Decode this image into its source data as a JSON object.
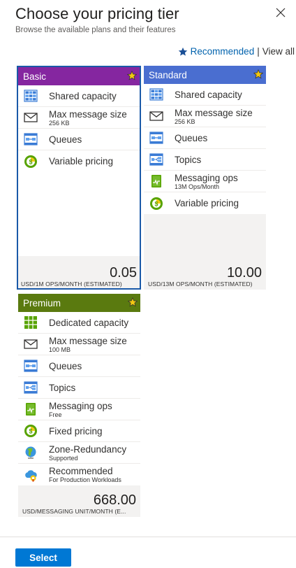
{
  "header": {
    "title": "Choose your pricing tier",
    "subtitle": "Browse the available plans and their features"
  },
  "filters": {
    "recommended_label": "Recommended",
    "separator": "|",
    "view_all_label": "View all"
  },
  "colors": {
    "basic": "#8526a0",
    "standard": "#4a6ed0",
    "premium": "#5a7a0f",
    "accent": "#0078d4",
    "selected_outline": "#1a59a8",
    "star": "#f2c811"
  },
  "tiers": {
    "basic": {
      "name": "Basic",
      "selected": true,
      "features": [
        {
          "icon": "shared-capacity-icon",
          "name": "Shared capacity",
          "detail": ""
        },
        {
          "icon": "envelope-icon",
          "name": "Max message size",
          "detail": "256 KB"
        },
        {
          "icon": "queue-icon",
          "name": "Queues",
          "detail": ""
        },
        {
          "icon": "pricing-coin-icon",
          "name": "Variable pricing",
          "detail": ""
        }
      ],
      "price": "0.05",
      "price_unit": "USD/1M OPS/MONTH (ESTIMATED)"
    },
    "standard": {
      "name": "Standard",
      "selected": false,
      "features": [
        {
          "icon": "shared-capacity-icon",
          "name": "Shared capacity",
          "detail": ""
        },
        {
          "icon": "envelope-icon",
          "name": "Max message size",
          "detail": "256 KB"
        },
        {
          "icon": "queue-icon",
          "name": "Queues",
          "detail": ""
        },
        {
          "icon": "topics-icon",
          "name": "Topics",
          "detail": ""
        },
        {
          "icon": "messaging-ops-icon",
          "name": "Messaging ops",
          "detail": "13M Ops/Month"
        },
        {
          "icon": "pricing-coin-icon",
          "name": "Variable pricing",
          "detail": ""
        }
      ],
      "price": "10.00",
      "price_unit": "USD/13M OPS/MONTH (ESTIMATED)"
    },
    "premium": {
      "name": "Premium",
      "selected": false,
      "features": [
        {
          "icon": "dedicated-capacity-icon",
          "name": "Dedicated capacity",
          "detail": ""
        },
        {
          "icon": "envelope-icon",
          "name": "Max message size",
          "detail": "100 MB"
        },
        {
          "icon": "queue-icon",
          "name": "Queues",
          "detail": ""
        },
        {
          "icon": "topics-icon",
          "name": "Topics",
          "detail": ""
        },
        {
          "icon": "messaging-ops-icon",
          "name": "Messaging ops",
          "detail": "Free"
        },
        {
          "icon": "pricing-coin-icon",
          "name": "Fixed pricing",
          "detail": ""
        },
        {
          "icon": "globe-icon",
          "name": "Zone-Redundancy",
          "detail": "Supported"
        },
        {
          "icon": "cloud-recommended-icon",
          "name": "Recommended",
          "detail": "For Production Workloads"
        }
      ],
      "price": "668.00",
      "price_unit": "USD/MESSAGING UNIT/MONTH (E..."
    }
  },
  "footer": {
    "select_label": "Select"
  }
}
